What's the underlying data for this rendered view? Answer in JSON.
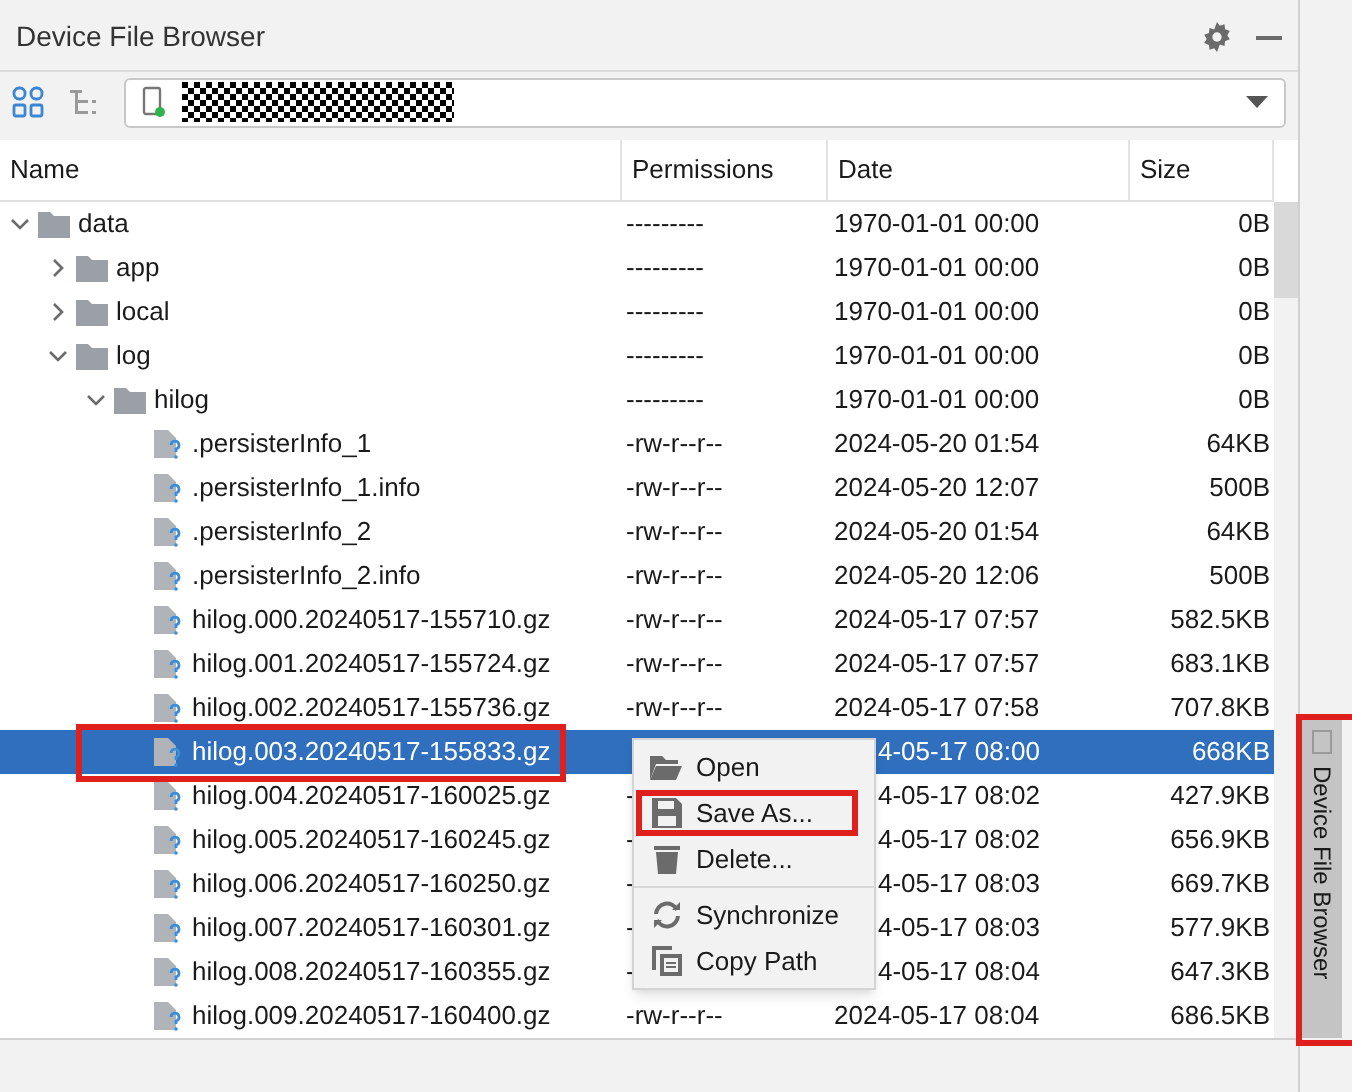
{
  "panel": {
    "title": "Device File Browser"
  },
  "columns": [
    "Name",
    "Permissions",
    "Date",
    "Size"
  ],
  "tree": [
    {
      "kind": "folder",
      "name": "data",
      "permissions": "---------",
      "date": "1970-01-01 00:00",
      "size": "0B",
      "expanded": true,
      "selected": false,
      "children": [
        {
          "kind": "folder",
          "name": "app",
          "permissions": "---------",
          "date": "1970-01-01 00:00",
          "size": "0B",
          "expanded": false,
          "selected": false
        },
        {
          "kind": "folder",
          "name": "local",
          "permissions": "---------",
          "date": "1970-01-01 00:00",
          "size": "0B",
          "expanded": false,
          "selected": false
        },
        {
          "kind": "folder",
          "name": "log",
          "permissions": "---------",
          "date": "1970-01-01 00:00",
          "size": "0B",
          "expanded": true,
          "selected": false,
          "children": [
            {
              "kind": "folder",
              "name": "hilog",
              "permissions": "---------",
              "date": "1970-01-01 00:00",
              "size": "0B",
              "expanded": true,
              "selected": false,
              "children": [
                {
                  "kind": "file",
                  "name": ".persisterInfo_1",
                  "permissions": "-rw-r--r--",
                  "date": "2024-05-20 01:54",
                  "size": "64KB",
                  "selected": false
                },
                {
                  "kind": "file",
                  "name": ".persisterInfo_1.info",
                  "permissions": "-rw-r--r--",
                  "date": "2024-05-20 12:07",
                  "size": "500B",
                  "selected": false
                },
                {
                  "kind": "file",
                  "name": ".persisterInfo_2",
                  "permissions": "-rw-r--r--",
                  "date": "2024-05-20 01:54",
                  "size": "64KB",
                  "selected": false
                },
                {
                  "kind": "file",
                  "name": ".persisterInfo_2.info",
                  "permissions": "-rw-r--r--",
                  "date": "2024-05-20 12:06",
                  "size": "500B",
                  "selected": false
                },
                {
                  "kind": "file",
                  "name": "hilog.000.20240517-155710.gz",
                  "permissions": "-rw-r--r--",
                  "date": "2024-05-17 07:57",
                  "size": "582.5KB",
                  "selected": false
                },
                {
                  "kind": "file",
                  "name": "hilog.001.20240517-155724.gz",
                  "permissions": "-rw-r--r--",
                  "date": "2024-05-17 07:57",
                  "size": "683.1KB",
                  "selected": false
                },
                {
                  "kind": "file",
                  "name": "hilog.002.20240517-155736.gz",
                  "permissions": "-rw-r--r--",
                  "date": "2024-05-17 07:58",
                  "size": "707.8KB",
                  "selected": false
                },
                {
                  "kind": "file",
                  "name": "hilog.003.20240517-155833.gz",
                  "date": "4-05-17 08:00",
                  "size": "668KB",
                  "selected": true,
                  "annotated": true
                },
                {
                  "kind": "file",
                  "name": "hilog.004.20240517-160025.gz",
                  "permissions": "-",
                  "date": "4-05-17 08:02",
                  "size": "427.9KB",
                  "selected": false
                },
                {
                  "kind": "file",
                  "name": "hilog.005.20240517-160245.gz",
                  "permissions": "-",
                  "date": "4-05-17 08:02",
                  "size": "656.9KB",
                  "selected": false
                },
                {
                  "kind": "file",
                  "name": "hilog.006.20240517-160250.gz",
                  "permissions": "-",
                  "date": "4-05-17 08:03",
                  "size": "669.7KB",
                  "selected": false
                },
                {
                  "kind": "file",
                  "name": "hilog.007.20240517-160301.gz",
                  "permissions": "-",
                  "date": "4-05-17 08:03",
                  "size": "577.9KB",
                  "selected": false
                },
                {
                  "kind": "file",
                  "name": "hilog.008.20240517-160355.gz",
                  "permissions": "-",
                  "date": "4-05-17 08:04",
                  "size": "647.3KB",
                  "selected": false
                },
                {
                  "kind": "file",
                  "name": "hilog.009.20240517-160400.gz",
                  "permissions": "-rw-r--r--",
                  "date": "2024-05-17 08:04",
                  "size": "686.5KB",
                  "selected": false
                }
              ]
            }
          ]
        }
      ]
    }
  ],
  "context_menu": [
    {
      "kind": "open",
      "label": "Open",
      "annotated": false
    },
    {
      "kind": "save",
      "label": "Save As...",
      "annotated": true
    },
    {
      "kind": "delete",
      "label": "Delete...",
      "annotated": false
    },
    {
      "kind": "sync",
      "label": "Synchronize",
      "annotated": false
    },
    {
      "kind": "copy",
      "label": "Copy Path",
      "annotated": false
    }
  ],
  "side_tab": {
    "label": "Device File Browser",
    "selected": true,
    "annotated": true
  }
}
